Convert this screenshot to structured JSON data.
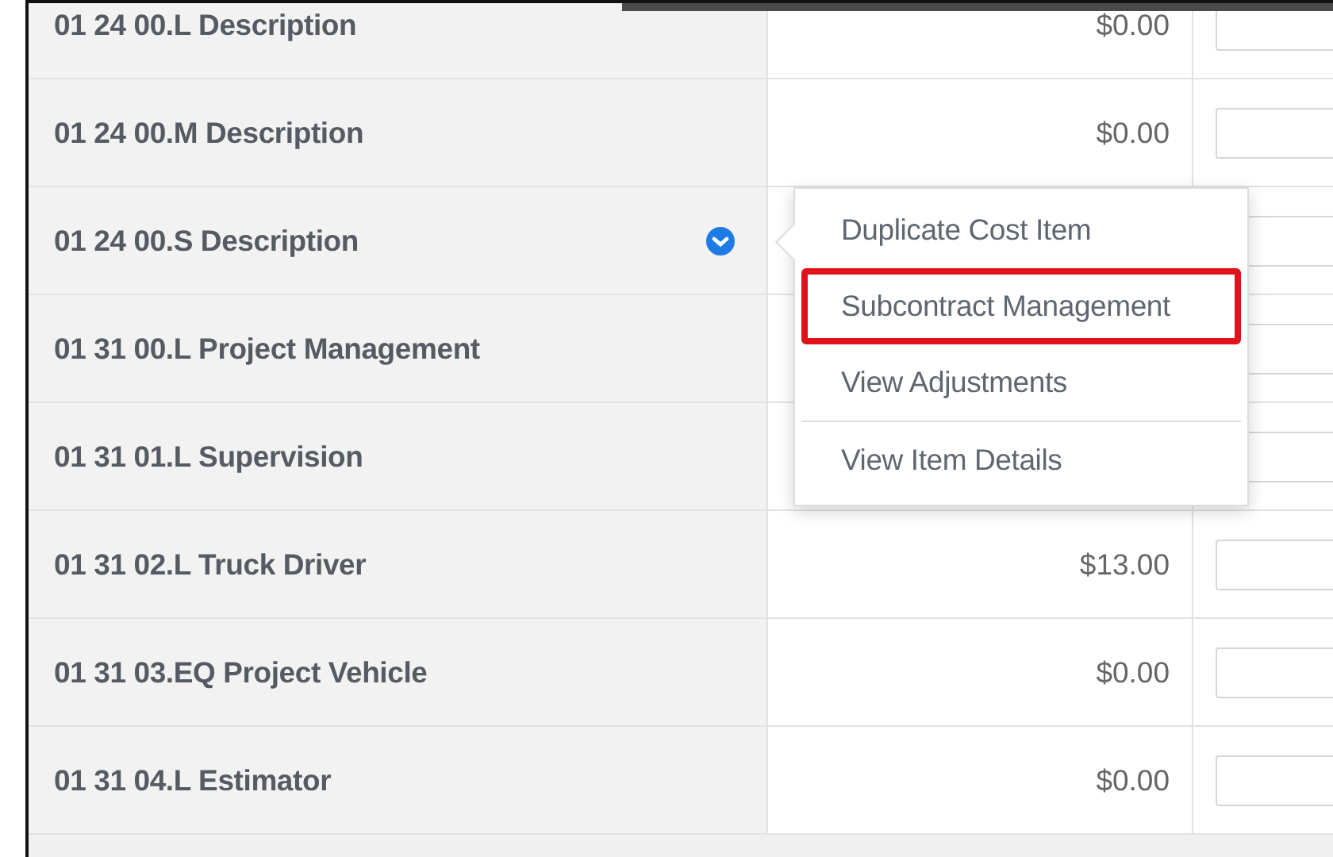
{
  "rows": [
    {
      "name": "01 24 00.L Description",
      "amount": "$0.00",
      "menu_open": false
    },
    {
      "name": "01 24 00.M Description",
      "amount": "$0.00",
      "menu_open": false
    },
    {
      "name": "01 24 00.S Description",
      "menu_open": true
    },
    {
      "name": "01 31 00.L Project Management",
      "menu_open": false
    },
    {
      "name": "01 31 01.L Supervision",
      "menu_open": false
    },
    {
      "name": "01 31 02.L Truck Driver",
      "amount": "$13.00",
      "menu_open": false
    },
    {
      "name": "01 31 03.EQ Project Vehicle",
      "amount": "$0.00",
      "menu_open": false
    },
    {
      "name": "01 31 04.L Estimator",
      "amount": "$0.00",
      "menu_open": false
    }
  ],
  "menu": {
    "items": [
      {
        "label": "Duplicate Cost Item",
        "highlighted": false
      },
      {
        "label": "Subcontract Management",
        "highlighted": true
      },
      {
        "label": "View Adjustments",
        "highlighted": false
      },
      {
        "label": "View Item Details",
        "highlighted": false
      }
    ]
  }
}
